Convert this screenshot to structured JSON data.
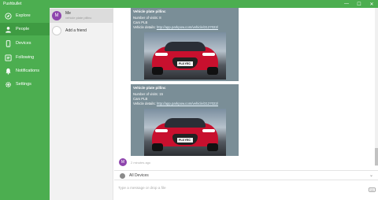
{
  "app": {
    "title": "Pushbullet",
    "window_controls": [
      "—",
      "☐",
      "✕"
    ]
  },
  "sidebar": {
    "items": [
      {
        "label": "Explore",
        "icon": "explore-icon",
        "active": false
      },
      {
        "label": "People",
        "icon": "people-icon",
        "active": true
      },
      {
        "label": "Devices",
        "icon": "devices-icon",
        "active": false
      },
      {
        "label": "Following",
        "icon": "following-icon",
        "active": false
      },
      {
        "label": "Notifications",
        "icon": "notifications-icon",
        "active": false
      },
      {
        "label": "Settings",
        "icon": "settings-icon",
        "active": false
      }
    ]
  },
  "contacts": {
    "me": {
      "initial": "M",
      "name": "Me",
      "sub": "vehicle plate pillinc"
    },
    "add": {
      "label": "Add a friend"
    }
  },
  "messages": [
    {
      "title": "Vehicle plate pillinc",
      "visits": "Number of visits: 8",
      "car": "Cars PLB",
      "details_prefix": "Vehicle details: ",
      "link": "http://app.parkpow.com/vehicle/3127023/",
      "plate": "PL8 YEC"
    },
    {
      "title": "Vehicle plate pillinc",
      "visits": "Number of visits: 15",
      "car": "Cars PLB",
      "details_prefix": "Vehicle details: ",
      "link": "http://app.parkpow.com/vehicle/3127023/",
      "plate": "PL8 YEC"
    }
  ],
  "meta": {
    "avatar_initial": "M",
    "time": "2 minutes ago"
  },
  "device_bar": {
    "label": "All Devices"
  },
  "composer": {
    "placeholder": "Type a message or drop a file"
  },
  "colors": {
    "brand": "#4cae50",
    "brand_dark": "#3e9b42",
    "avatar": "#8e44ad",
    "push_card": "#7a8e97"
  }
}
